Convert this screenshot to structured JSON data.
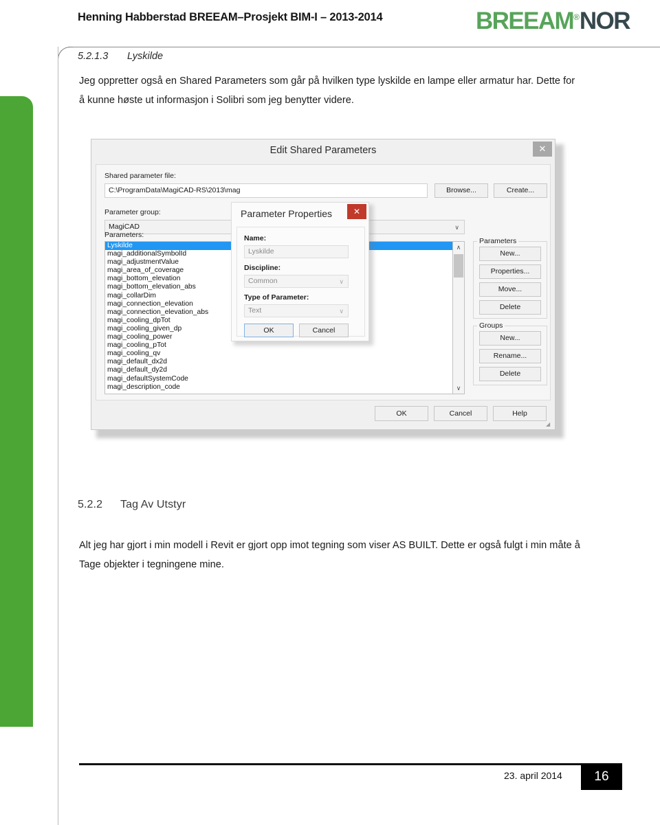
{
  "header": {
    "title": "Henning Habberstad BREEAM–Prosjekt BIM-I – 2013-2014",
    "logo_main": "BREEAM",
    "logo_reg": "®",
    "logo_sub": "NOR"
  },
  "sections": [
    {
      "number": "5.2.1.3",
      "title": "Lyskilde",
      "paragraph": "Jeg oppretter også en Shared Parameters som går på hvilken type lyskilde en lampe eller armatur har. Dette for å kunne høste ut informasjon i Solibri som jeg benytter videre."
    },
    {
      "number": "5.2.2",
      "title": "Tag Av Utstyr",
      "paragraph": "Alt jeg har gjort i min modell i Revit er gjort opp imot tegning som viser AS BUILT. Dette er også fulgt i min måte å Tage objekter i tegningene mine."
    }
  ],
  "screenshot": {
    "edit_shared_parameters": {
      "title": "Edit Shared Parameters",
      "close_label": "✕",
      "shared_parameter_file_label": "Shared parameter file:",
      "shared_parameter_file_value": "C:\\ProgramData\\MagiCAD-RS\\2013\\mag",
      "browse_label": "Browse...",
      "create_label": "Create...",
      "parameter_group_label": "Parameter group:",
      "parameter_group_value": "MagiCAD",
      "parameters_label": "Parameters:",
      "parameter_items": [
        "Lyskilde",
        "magi_additionalSymbolId",
        "magi_adjustmentValue",
        "magi_area_of_coverage",
        "magi_bottom_elevation",
        "magi_bottom_elevation_abs",
        "magi_collarDim",
        "magi_connection_elevation",
        "magi_connection_elevation_abs",
        "magi_cooling_dpTot",
        "magi_cooling_given_dp",
        "magi_cooling_power",
        "magi_cooling_pTot",
        "magi_cooling_qv",
        "magi_default_dx2d",
        "magi_default_dy2d",
        "magi_defaultSystemCode",
        "magi_description_code"
      ],
      "selected_parameter": "Lyskilde",
      "scroll_up_glyph": "∧",
      "scroll_down_glyph": "∨",
      "parameters_group_title": "Parameters",
      "parameters_group_buttons": [
        "New...",
        "Properties...",
        "Move...",
        "Delete"
      ],
      "groups_group_title": "Groups",
      "groups_group_buttons": [
        "New...",
        "Rename...",
        "Delete"
      ],
      "footer_buttons": [
        "OK",
        "Cancel",
        "Help"
      ],
      "resizer_glyph": "◢"
    },
    "parameter_properties": {
      "title": "Parameter Properties",
      "close_label": "✕",
      "name_label": "Name:",
      "name_value": "Lyskilde",
      "discipline_label": "Discipline:",
      "discipline_value": "Common",
      "type_label": "Type of Parameter:",
      "type_value": "Text",
      "ok_label": "OK",
      "cancel_label": "Cancel",
      "chevron_glyph": "∨"
    }
  },
  "footer": {
    "date": "23. april 2014",
    "page_number": "16"
  },
  "colors": {
    "brand_green": "#57a45a",
    "brand_dark": "#36484d",
    "sidebar_green": "#4ba635",
    "selection_blue": "#2196f3",
    "close_red": "#c0392b",
    "footer_black": "#000000"
  }
}
